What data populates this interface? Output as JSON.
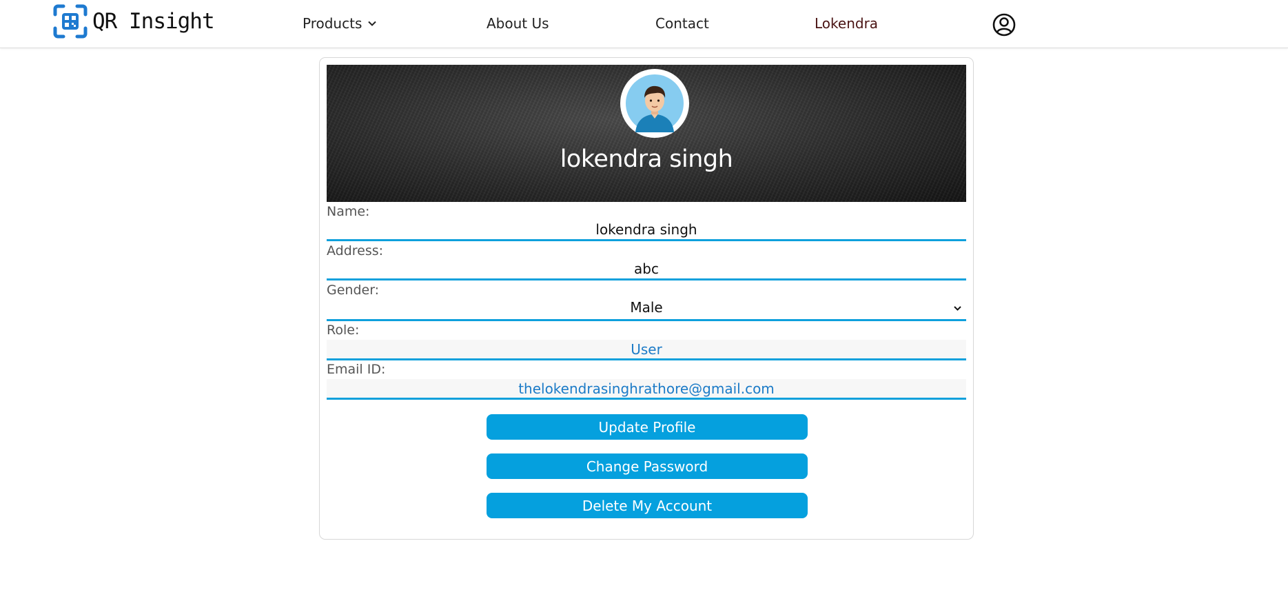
{
  "brand": {
    "name": "QR Insight",
    "color": "#1e7ad0"
  },
  "nav": {
    "products": "Products",
    "about": "About Us",
    "contact": "Contact",
    "user": "Lokendra"
  },
  "icons": {
    "logo": "qr-logo-icon",
    "products_caret": "chevron-down-icon",
    "account": "account-circle-icon",
    "gender_caret": "chevron-down-icon"
  },
  "profile": {
    "display_name": "lokendra singh",
    "fields": {
      "name_label": "Name:",
      "name_value": "lokendra singh",
      "address_label": "Address:",
      "address_value": "abc",
      "gender_label": "Gender:",
      "gender_value": "Male",
      "role_label": "Role:",
      "role_value": "User",
      "email_label": "Email ID:",
      "email_value": "thelokendrasinghrathore@gmail.com"
    }
  },
  "buttons": {
    "update": "Update Profile",
    "change_password": "Change Password",
    "delete": "Delete My Account"
  },
  "colors": {
    "accent": "#05a0de",
    "field_underline": "#0ea0dc",
    "readonly_text": "#1c7bc7",
    "active_nav": "#4a1414"
  }
}
